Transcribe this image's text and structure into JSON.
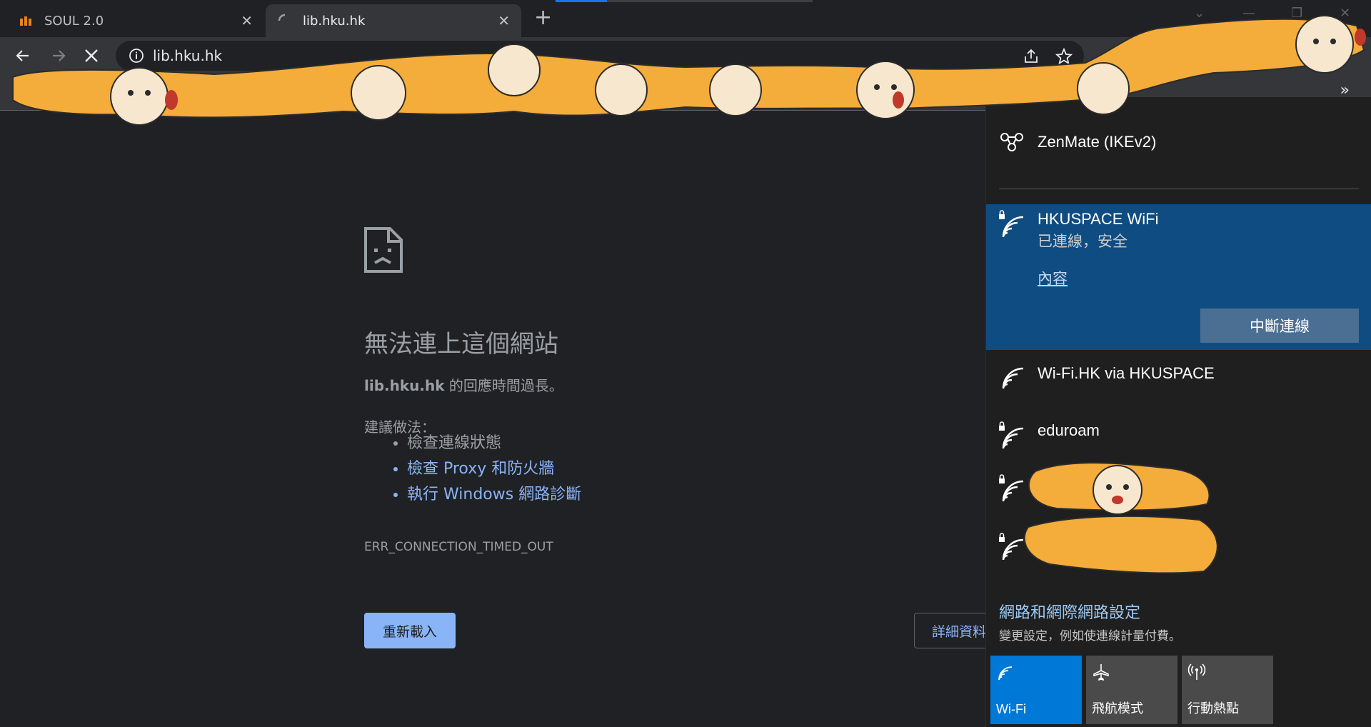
{
  "browser": {
    "tabs": [
      {
        "title": "SOUL 2.0",
        "close": "✕"
      },
      {
        "title": "lib.hku.hk",
        "close": "✕"
      }
    ],
    "new_tab": "+",
    "url": "lib.hku.hk",
    "bookmarks_overflow": "»",
    "page_load_progress": 0.2
  },
  "error_page": {
    "heading": "無法連上這個網站",
    "host": "lib.hku.hk",
    "message": " 的回應時間過長。",
    "suggestions_label": "建議做法：",
    "suggestions": [
      "檢查連線狀態",
      "檢查 Proxy 和防火牆",
      "執行 Windows 網路診斷"
    ],
    "error_code": "ERR_CONNECTION_TIMED_OUT",
    "reload_label": "重新載入",
    "details_label": "詳細資料"
  },
  "network_flyout": {
    "vpn": {
      "name": "ZenMate (IKEv2)"
    },
    "connected": {
      "name": "HKUSPACE WiFi",
      "status": "已連線，安全",
      "properties": "內容",
      "disconnect": "中斷連線"
    },
    "networks": [
      {
        "name": "Wi-Fi.HK via HKUSPACE",
        "secured": false
      },
      {
        "name": "eduroam",
        "secured": true
      }
    ],
    "settings_link": "網路和網際網路設定",
    "settings_desc": "變更設定，例如使連線計量付費。",
    "quick_actions": [
      {
        "label": "Wi-Fi",
        "icon": "wifi-icon",
        "active": true
      },
      {
        "label": "飛航模式",
        "icon": "airplane-icon",
        "active": false
      },
      {
        "label": "行動熱點",
        "icon": "hotspot-icon",
        "active": false
      }
    ]
  },
  "colors": {
    "accent": "#0078d7",
    "connected_bg": "#0f4c81",
    "link": "#8ab4f8",
    "shiba": "#f4ac3a"
  }
}
